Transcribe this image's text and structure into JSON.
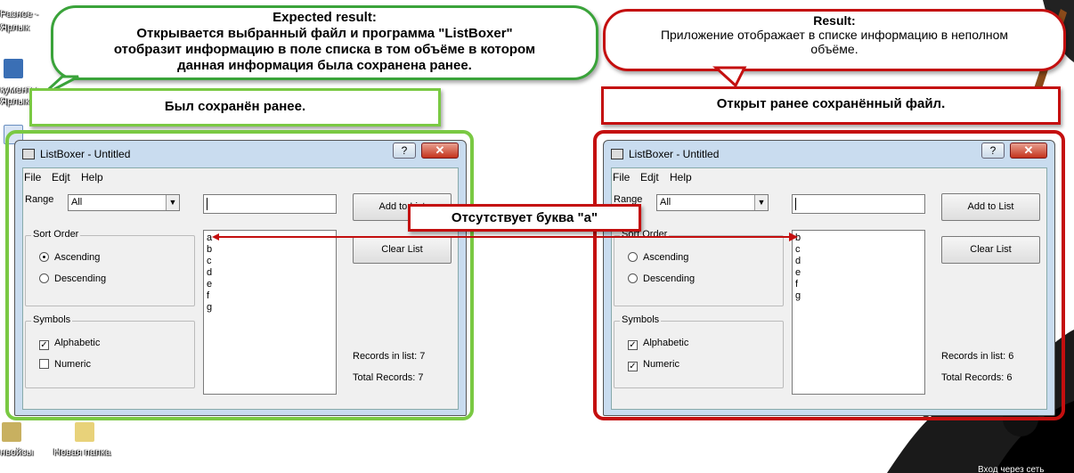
{
  "desktop": {
    "icons": [
      {
        "label": "Разное -"
      },
      {
        "label": "Ярлык"
      },
      {
        "label": "кументы -"
      },
      {
        "label": "Ярлык"
      },
      {
        "label": "нвойсы"
      },
      {
        "label": "Новая папка"
      },
      {
        "label": "Вход через сеть"
      }
    ]
  },
  "callouts": {
    "expected": {
      "title": "Expected result:",
      "line1": "Открывается выбранный файл и программа \"ListBoxer\"",
      "line2": "отобразит информацию в поле списка в том объёме в котором",
      "line3": "данная информация была сохранена ранее."
    },
    "result": {
      "title": "Result:",
      "line1": "Приложение отображает в списке информацию в неполном",
      "line2": "объёме."
    },
    "saved_label": "Был сохранён ранее.",
    "opened_label": "Открыт ранее сохранённый файл.",
    "missing_label": "Отсутствует буква \"а\""
  },
  "window_left": {
    "title": "ListBoxer - Untitled",
    "help_btn": "?",
    "close_btn": "✕",
    "menu": [
      "File",
      "Edjt",
      "Help"
    ],
    "range_label": "Range",
    "range_value": "All",
    "sort_order_label": "Sort Order",
    "ascending_label": "Ascending",
    "descending_label": "Descending",
    "ascending_checked": true,
    "symbols_label": "Symbols",
    "alphabetic_label": "Alphabetic",
    "numeric_label": "Numeric",
    "alphabetic_checked": true,
    "numeric_checked": false,
    "list_items": [
      "a",
      "b",
      "c",
      "d",
      "e",
      "f",
      "g"
    ],
    "add_button": "Add to List",
    "clear_button": "Clear List",
    "records_in_list": "Records in list: 7",
    "total_records": "Total Records: 7"
  },
  "window_right": {
    "title": "ListBoxer - Untitled",
    "help_btn": "?",
    "close_btn": "✕",
    "menu": [
      "File",
      "Edjt",
      "Help"
    ],
    "range_label": "Range",
    "range_value": "All",
    "sort_order_label": "Sort Order",
    "ascending_label": "Ascending",
    "descending_label": "Descending",
    "ascending_checked": false,
    "symbols_label": "Symbols",
    "alphabetic_label": "Alphabetic",
    "numeric_label": "Numeric",
    "alphabetic_checked": true,
    "numeric_checked": true,
    "list_items": [
      "b",
      "c",
      "d",
      "e",
      "f",
      "g"
    ],
    "add_button": "Add to List",
    "clear_button": "Clear List",
    "records_in_list": "Records in list: 6",
    "total_records": "Total Records: 6"
  },
  "colors": {
    "expected_border": "#3aa33a",
    "result_border": "#c40f0f",
    "saved_border": "#7ac943"
  }
}
